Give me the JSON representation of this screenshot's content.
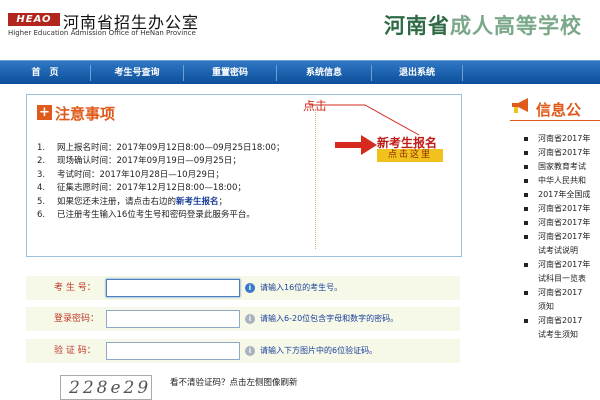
{
  "header": {
    "logo_mark": "HEAO",
    "office_name": "河南省招生办公室",
    "office_en": "Higher Education Admission Office of HeNan Province",
    "site_title_part1": "河南省",
    "site_title_part2": "成人高等学校"
  },
  "nav": {
    "items": [
      "首　页",
      "考生号查询",
      "重置密码",
      "系统信息",
      "退出系统"
    ]
  },
  "notice": {
    "title": "注意事项",
    "items": [
      {
        "num": "1.",
        "text": "网上报名时间：2017年09月12日8:00—09月25日18:00；"
      },
      {
        "num": "2.",
        "text": "现场确认时间：2017年09月19日—09月25日；"
      },
      {
        "num": "3.",
        "text": "考试时间：2017年10月28日—10月29日；"
      },
      {
        "num": "4.",
        "text": "征集志愿时间：2017年12月12日8:00—18:00；"
      },
      {
        "num": "5.",
        "text_before": "如果您还未注册，请点击右边的",
        "link": "新考生报名",
        "text_after": "；"
      },
      {
        "num": "6.",
        "text": "已注册考生输入16位考生号和密码登录此服务平台。"
      }
    ],
    "click_hint": "点击",
    "new_register": "新考生报名",
    "click_here": "点击这里"
  },
  "news": {
    "title": "信息公",
    "items": [
      {
        "text": "河南省2017年",
        "bullet": true
      },
      {
        "text": "河南省2017年",
        "bullet": true
      },
      {
        "text": "国家教育考试",
        "bullet": true
      },
      {
        "text": "中华人民共和",
        "bullet": true
      },
      {
        "text": "2017年全国成",
        "bullet": true
      },
      {
        "text": "河南省2017年",
        "bullet": true
      },
      {
        "text": "河南省2017年",
        "bullet": true
      },
      {
        "text": "河南省2017年",
        "bullet": true
      },
      {
        "text": "试考试说明",
        "bullet": false
      },
      {
        "text": "河南省2017年",
        "bullet": true
      },
      {
        "text": "试科目一览表",
        "bullet": false
      },
      {
        "text": "河南省2017",
        "bullet": true
      },
      {
        "text": "须知",
        "bullet": false
      },
      {
        "text": "河南省2017",
        "bullet": true
      },
      {
        "text": "试考生须知",
        "bullet": false
      }
    ]
  },
  "form": {
    "exam_no_label": "考 生 号：",
    "exam_no_tip": "请输入16位的考生号。",
    "password_label": "登录密码：",
    "password_tip": "请输入6-20位包含字母和数字的密码。",
    "captcha_label": "验 证 码：",
    "captcha_tip": "请输入下方图片中的6位验证码。",
    "captcha_text": "228e29",
    "captcha_note": "看不清验证码？点击左侧图像刷新"
  }
}
